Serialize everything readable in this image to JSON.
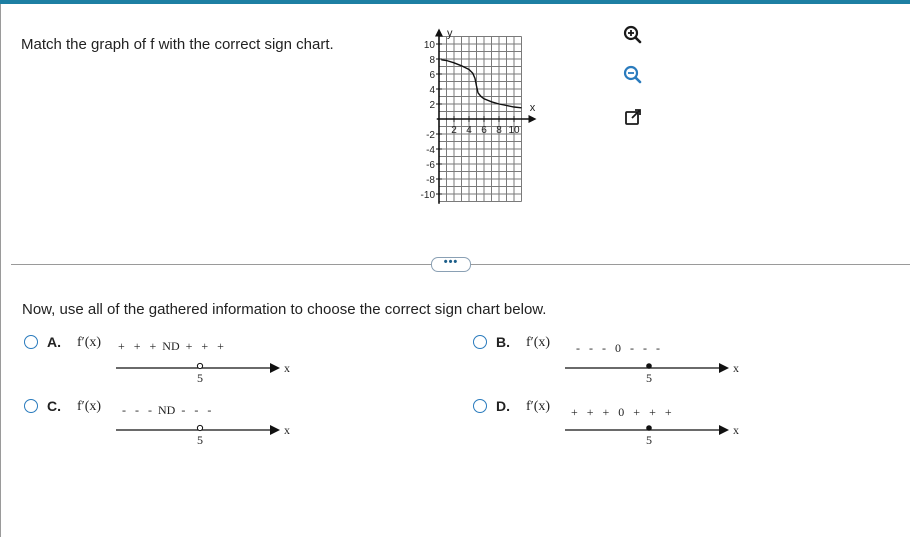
{
  "question": {
    "prompt": "Match the graph of f with the correct sign chart.",
    "instruction": "Now, use all of the gathered information to choose the correct sign chart below."
  },
  "graph": {
    "y_axis_label": "y",
    "x_axis_label": "x",
    "x_tick_labels": [
      "2",
      "4",
      "6",
      "8",
      "10"
    ],
    "y_tick_labels": [
      "10",
      "8",
      "6",
      "4",
      "2",
      "-2",
      "-4",
      "-6",
      "-8",
      "-10"
    ],
    "curve_points": [
      [
        0.3,
        7.9
      ],
      [
        1,
        7.8
      ],
      [
        2,
        7.5
      ],
      [
        3,
        7.1
      ],
      [
        4,
        6.6
      ],
      [
        4.5,
        6.1
      ],
      [
        4.8,
        5.4
      ],
      [
        5,
        4.4
      ],
      [
        5.2,
        3.5
      ],
      [
        5.6,
        3.0
      ],
      [
        6,
        2.7
      ],
      [
        7,
        2.3
      ],
      [
        8,
        2.0
      ],
      [
        9,
        1.8
      ],
      [
        10,
        1.6
      ],
      [
        11,
        1.5
      ]
    ]
  },
  "tools": [
    {
      "name": "zoom-in-icon"
    },
    {
      "name": "zoom-out-icon"
    },
    {
      "name": "expand-icon"
    }
  ],
  "more_button": {
    "label": "•••"
  },
  "options": [
    {
      "letter": "A.",
      "label": "f′(x)",
      "signs": "+   +   +  ND  +   +   +",
      "center": "ND",
      "point_label": "5",
      "axis_label": "x",
      "point_style": "open"
    },
    {
      "letter": "B.",
      "label": "f′(x)",
      "signs": "-   -   -   0   -   -   -",
      "center": "0",
      "point_label": "5",
      "axis_label": "x",
      "point_style": "closed"
    },
    {
      "letter": "C.",
      "label": "f′(x)",
      "signs": "-   -   -  ND  -   -   -",
      "center": "ND",
      "point_label": "5",
      "axis_label": "x",
      "point_style": "open"
    },
    {
      "letter": "D.",
      "label": "f′(x)",
      "signs": "+   +   +   0   +   +   +",
      "center": "0",
      "point_label": "5",
      "axis_label": "x",
      "point_style": "closed"
    }
  ],
  "colors": {
    "accent": "#1d7fa3",
    "radio": "#2a7bbd",
    "grid": "#7a7a7a",
    "divider": "#9a9a9a"
  }
}
